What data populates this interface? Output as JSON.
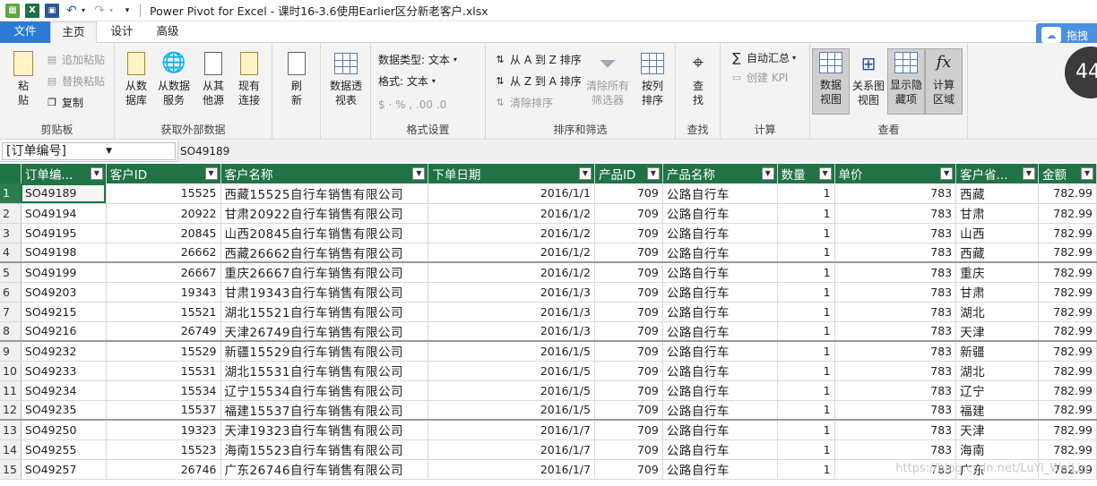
{
  "title_bar": {
    "title": "Power Pivot for Excel - 课时16-3.6使用Earlier区分新老客户.xlsx"
  },
  "tabs": [
    {
      "label": "文件"
    },
    {
      "label": "主页"
    },
    {
      "label": "设计"
    },
    {
      "label": "高级"
    }
  ],
  "overlay": {
    "drag_label": "拖拽",
    "badge": "44"
  },
  "ribbon": {
    "clipboard": {
      "label": "剪贴板",
      "paste": "粘\n贴",
      "append_paste": "追加粘贴",
      "replace_paste": "替换粘贴",
      "copy": "复制"
    },
    "external": {
      "label": "获取外部数据",
      "from_db": "从数\n据库",
      "from_service": "从数据\n服务",
      "from_other": "从其\n他源",
      "existing": "现有\n连接"
    },
    "refresh": {
      "label": "刷\n新"
    },
    "pivot": {
      "label": "数据透\n视表"
    },
    "format": {
      "label": "格式设置",
      "data_type": "数据类型: 文本",
      "format": "格式: 文本",
      "symbols": "$ · % ,  .00 .0"
    },
    "sort": {
      "label": "排序和筛选",
      "asc": "从 A 到 Z 排序",
      "desc": "从 Z 到 A 排序",
      "clear_sort": "清除排序",
      "clear_filter": "清除所有\n筛选器",
      "sort_by_col": "按列\n排序"
    },
    "find": {
      "label": "查找",
      "btn": "查\n找"
    },
    "calc": {
      "label": "计算",
      "autosum": "自动汇总",
      "kpi": "创建 KPI"
    },
    "view": {
      "label": "查看",
      "data_view": "数据\n视图",
      "diagram_view": "关系图\n视图",
      "show_hidden": "显示隐\n藏项",
      "calc_area": "计算\n区域"
    }
  },
  "formula_bar": {
    "name_box": "[订单编号]",
    "value": "SO49189"
  },
  "grid": {
    "columns": [
      "订单编...",
      "客户ID",
      "客户名称",
      "下单日期",
      "产品ID",
      "产品名称",
      "数量",
      "单价",
      "客户省...",
      "金额"
    ],
    "rows": [
      [
        "SO49189",
        "15525",
        "西藏15525自行车销售有限公司",
        "2016/1/1",
        "709",
        "公路自行车",
        "1",
        "783",
        "西藏",
        "782.99"
      ],
      [
        "SO49194",
        "20922",
        "甘肃20922自行车销售有限公司",
        "2016/1/2",
        "709",
        "公路自行车",
        "1",
        "783",
        "甘肃",
        "782.99"
      ],
      [
        "SO49195",
        "20845",
        "山西20845自行车销售有限公司",
        "2016/1/2",
        "709",
        "公路自行车",
        "1",
        "783",
        "山西",
        "782.99"
      ],
      [
        "SO49198",
        "26662",
        "西藏26662自行车销售有限公司",
        "2016/1/2",
        "709",
        "公路自行车",
        "1",
        "783",
        "西藏",
        "782.99"
      ],
      [
        "SO49199",
        "26667",
        "重庆26667自行车销售有限公司",
        "2016/1/2",
        "709",
        "公路自行车",
        "1",
        "783",
        "重庆",
        "782.99"
      ],
      [
        "SO49203",
        "19343",
        "甘肃19343自行车销售有限公司",
        "2016/1/3",
        "709",
        "公路自行车",
        "1",
        "783",
        "甘肃",
        "782.99"
      ],
      [
        "SO49215",
        "15521",
        "湖北15521自行车销售有限公司",
        "2016/1/3",
        "709",
        "公路自行车",
        "1",
        "783",
        "湖北",
        "782.99"
      ],
      [
        "SO49216",
        "26749",
        "天津26749自行车销售有限公司",
        "2016/1/3",
        "709",
        "公路自行车",
        "1",
        "783",
        "天津",
        "782.99"
      ],
      [
        "SO49232",
        "15529",
        "新疆15529自行车销售有限公司",
        "2016/1/5",
        "709",
        "公路自行车",
        "1",
        "783",
        "新疆",
        "782.99"
      ],
      [
        "SO49233",
        "15531",
        "湖北15531自行车销售有限公司",
        "2016/1/5",
        "709",
        "公路自行车",
        "1",
        "783",
        "湖北",
        "782.99"
      ],
      [
        "SO49234",
        "15534",
        "辽宁15534自行车销售有限公司",
        "2016/1/5",
        "709",
        "公路自行车",
        "1",
        "783",
        "辽宁",
        "782.99"
      ],
      [
        "SO49235",
        "15537",
        "福建15537自行车销售有限公司",
        "2016/1/5",
        "709",
        "公路自行车",
        "1",
        "783",
        "福建",
        "782.99"
      ],
      [
        "SO49250",
        "19323",
        "天津19323自行车销售有限公司",
        "2016/1/7",
        "709",
        "公路自行车",
        "1",
        "783",
        "天津",
        "782.99"
      ],
      [
        "SO49255",
        "15523",
        "海南15523自行车销售有限公司",
        "2016/1/7",
        "709",
        "公路自行车",
        "1",
        "783",
        "海南",
        "782.99"
      ],
      [
        "SO49257",
        "26746",
        "广东26746自行车销售有限公司",
        "2016/1/7",
        "709",
        "公路自行车",
        "1",
        "783",
        "广东",
        "782.99"
      ]
    ]
  },
  "watermark": "https://blog.csdn.net/LuYi_WeiLin",
  "colors": {
    "header_bg": "#217346",
    "file_tab": "#2b7bd6"
  }
}
